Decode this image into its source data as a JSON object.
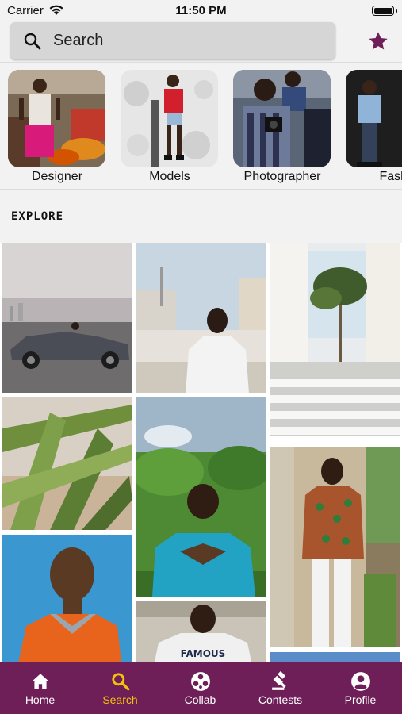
{
  "status_bar": {
    "carrier": "Carrier",
    "time": "11:50 PM"
  },
  "search": {
    "placeholder": "Search"
  },
  "header": {
    "favorite_icon": "star-icon",
    "accent_color": "#6e1f58"
  },
  "categories": [
    {
      "label": "Designer"
    },
    {
      "label": "Models"
    },
    {
      "label": "Photographer"
    },
    {
      "label": "Fashi"
    }
  ],
  "explore": {
    "title": "Explore"
  },
  "tab_bar": {
    "background": "#6e1f58",
    "active_color": "#f4c20d",
    "items": [
      {
        "label": "Home",
        "icon": "home-icon"
      },
      {
        "label": "Search",
        "icon": "search-icon",
        "active": true
      },
      {
        "label": "Collab",
        "icon": "collab-icon"
      },
      {
        "label": "Contests",
        "icon": "gavel-icon"
      },
      {
        "label": "Profile",
        "icon": "profile-icon"
      }
    ]
  },
  "grid_caption": {
    "shirt_text": "FAMOUS"
  }
}
